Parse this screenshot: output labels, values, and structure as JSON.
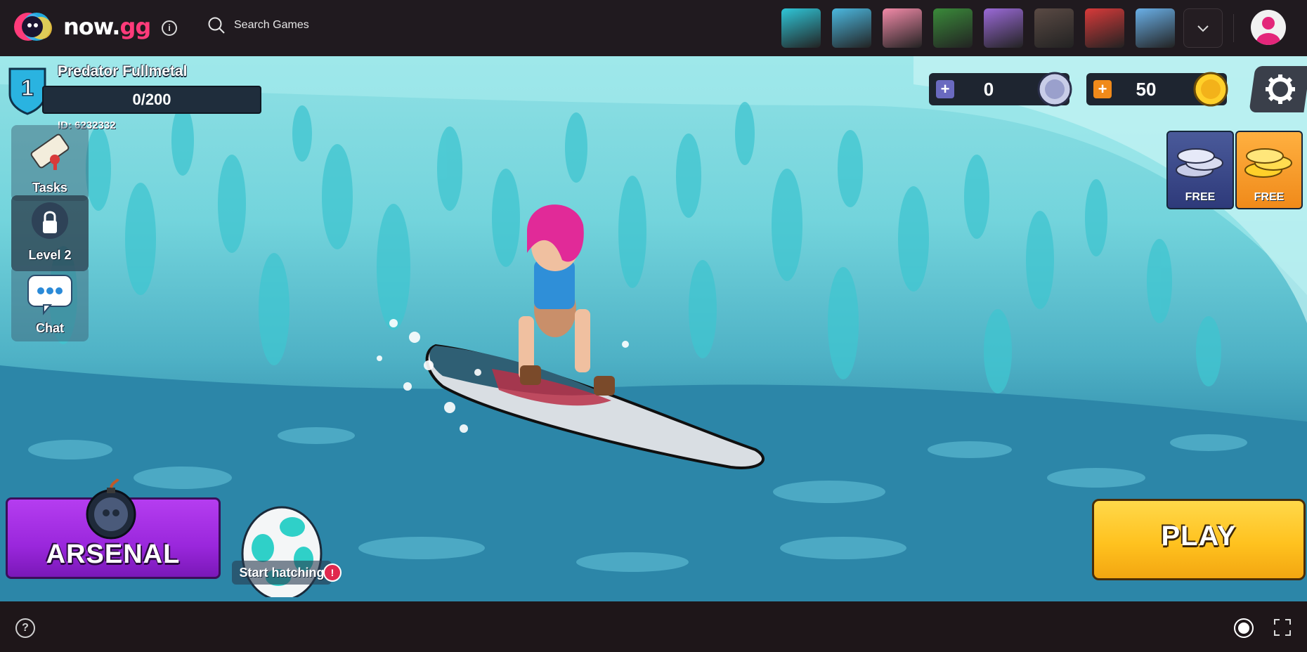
{
  "topbar": {
    "logo_text_main": "now.",
    "logo_text_accent": "gg",
    "search_label": "Search Games",
    "game_thumbs": [
      {
        "name": "game-thumb-1",
        "color": "#2fc6d8"
      },
      {
        "name": "game-thumb-2",
        "color": "#4bb8e0"
      },
      {
        "name": "game-thumb-3",
        "color": "#f28aa8"
      },
      {
        "name": "game-thumb-4",
        "color": "#3a8a3a"
      },
      {
        "name": "game-thumb-5",
        "color": "#9b6ad8"
      },
      {
        "name": "game-thumb-6",
        "color": "#5a4a44"
      },
      {
        "name": "game-thumb-7",
        "color": "#d83a3a"
      },
      {
        "name": "game-thumb-8",
        "color": "#6ab0e8"
      }
    ]
  },
  "player": {
    "level": "1",
    "name": "Predator Fullmetal",
    "xp": "0/200",
    "id": "ID: 6232332"
  },
  "sidebar": {
    "tasks_label": "Tasks",
    "level2_label": "Level 2",
    "chat_label": "Chat"
  },
  "currencies": {
    "silver_amount": "0",
    "gold_amount": "50"
  },
  "offers": {
    "silver_free_label": "FREE",
    "gold_free_label": "FREE"
  },
  "actions": {
    "arsenal_label": "ARSENAL",
    "hatch_label": "Start hatching",
    "hatch_badge": "!",
    "play_label": "PLAY"
  },
  "colors": {
    "accent": "#ff3b7a",
    "arsenal": "#9a27dc",
    "play": "#ffc21f",
    "shield": "#2ab3e0"
  }
}
